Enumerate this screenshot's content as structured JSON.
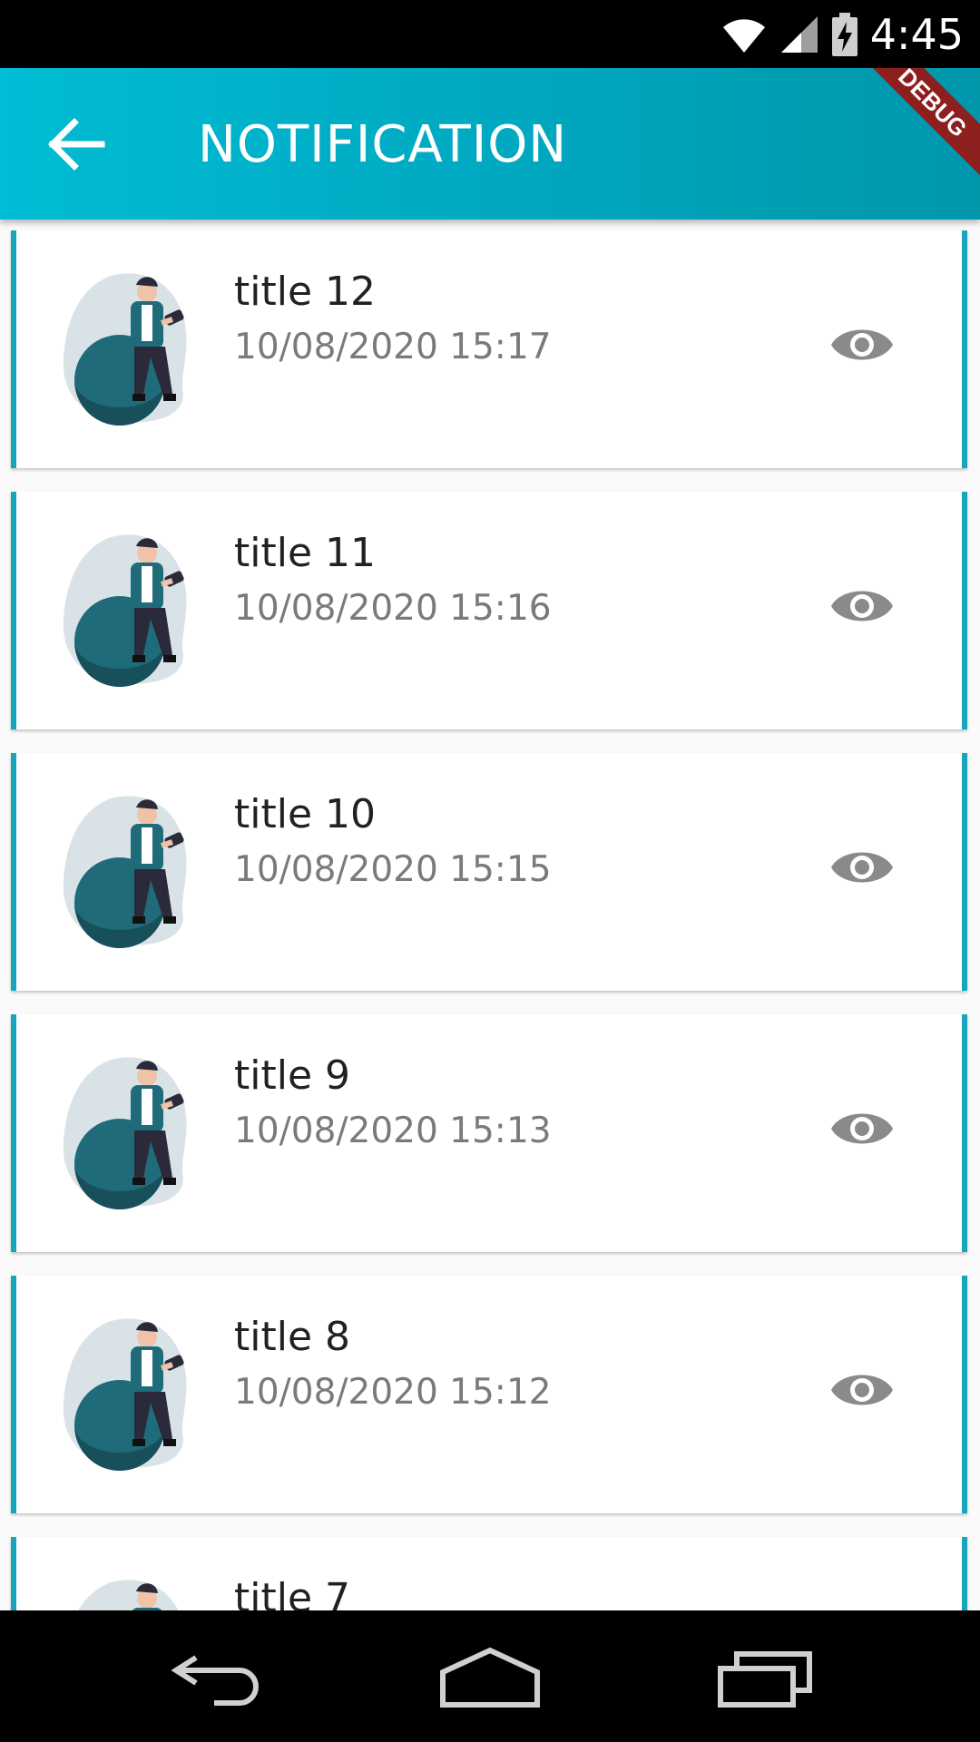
{
  "status_bar": {
    "time": "4:45",
    "icons": [
      "wifi-icon",
      "cell-signal-icon",
      "battery-charging-icon"
    ]
  },
  "app_bar": {
    "title": "NOTIFICATION",
    "back_icon": "arrow-back-icon",
    "debug_label": "DEBUG"
  },
  "colors": {
    "accent": "#00bcd4",
    "card_border": "#16a6bc",
    "eye": "#8a8a8a",
    "avatar_teal": "#1f6b7a"
  },
  "notifications": [
    {
      "title": "title 12",
      "date": "10/08/2020 15:17"
    },
    {
      "title": "title 11",
      "date": "10/08/2020 15:16"
    },
    {
      "title": "title 10",
      "date": "10/08/2020 15:15"
    },
    {
      "title": "title 9",
      "date": "10/08/2020 15:13"
    },
    {
      "title": "title 8",
      "date": "10/08/2020 15:12"
    },
    {
      "title": "title 7",
      "date": ""
    }
  ],
  "nav_bar": {
    "icons": [
      "nav-back-icon",
      "nav-home-icon",
      "nav-recents-icon"
    ]
  }
}
